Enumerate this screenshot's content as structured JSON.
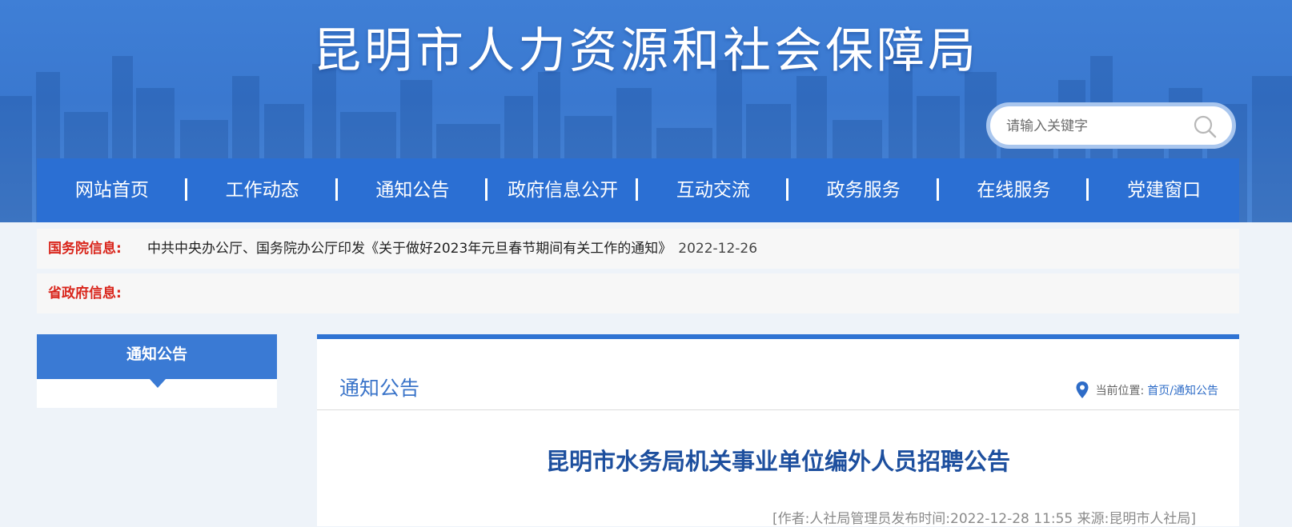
{
  "site": {
    "title": "昆明市人力资源和社会保障局"
  },
  "search": {
    "placeholder": "请输入关键字",
    "icon": "search-icon"
  },
  "nav": {
    "items": [
      "网站首页",
      "工作动态",
      "通知公告",
      "政府信息公开",
      "互动交流",
      "政务服务",
      "在线服务",
      "党建窗口"
    ]
  },
  "info_bars": {
    "state_council": {
      "label": "国务院信息:",
      "link_text": "中共中央办公厅、国务院办公厅印发《关于做好2023年元旦春节期间有关工作的通知》",
      "date": "2022-12-26"
    },
    "province": {
      "label": "省政府信息:"
    }
  },
  "sidebar": {
    "heading": "通知公告"
  },
  "main": {
    "section_title": "通知公告",
    "breadcrumb": {
      "label": "当前位置:",
      "path": "首页/通知公告",
      "icon": "location-pin-icon"
    },
    "article": {
      "title": "昆明市水务局机关事业单位编外人员招聘公告",
      "meta": "[作者:人社局管理员发布时间:2022-12-28 11:55 来源:昆明市人社局]"
    }
  },
  "colors": {
    "banner": "#3f7fd6",
    "nav": "#2b6fd3",
    "label_red": "#d9261c",
    "article_title": "#1d4f9e",
    "section_title": "#3a74c9"
  }
}
